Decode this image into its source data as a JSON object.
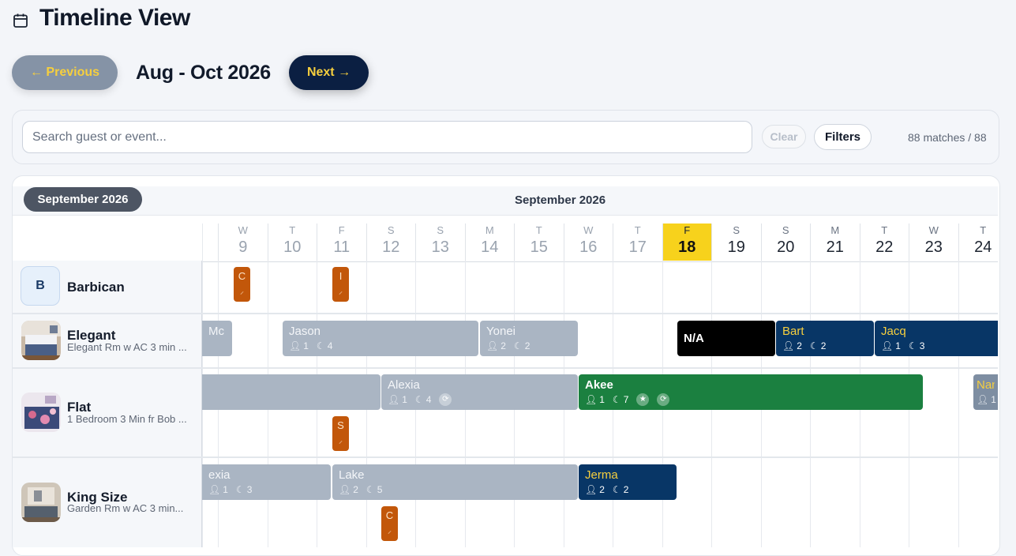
{
  "header": {
    "title": "Timeline View",
    "title_icon": "calendar-icon"
  },
  "nav": {
    "prev_label": "← Previous",
    "range_label": "Aug - Oct 2026",
    "next_label": "Next →"
  },
  "search": {
    "placeholder": "Search guest or event...",
    "value": "",
    "clear_label": "Clear",
    "filters_label": "Filters",
    "match_count": "88 matches / 88"
  },
  "timeline": {
    "month_pill": "September 2026",
    "month_heading": "September 2026",
    "days": [
      {
        "dow": "W",
        "num": "9"
      },
      {
        "dow": "T",
        "num": "10"
      },
      {
        "dow": "F",
        "num": "11"
      },
      {
        "dow": "S",
        "num": "12"
      },
      {
        "dow": "S",
        "num": "13"
      },
      {
        "dow": "M",
        "num": "14"
      },
      {
        "dow": "T",
        "num": "15"
      },
      {
        "dow": "W",
        "num": "16"
      },
      {
        "dow": "T",
        "num": "17"
      },
      {
        "dow": "F",
        "num": "18"
      },
      {
        "dow": "S",
        "num": "19"
      },
      {
        "dow": "S",
        "num": "20"
      },
      {
        "dow": "M",
        "num": "21"
      },
      {
        "dow": "T",
        "num": "22"
      },
      {
        "dow": "W",
        "num": "23"
      },
      {
        "dow": "T",
        "num": "24"
      }
    ],
    "today_index": 9,
    "rooms": [
      {
        "name": "Barbican",
        "subtitle": "",
        "initial": "B"
      },
      {
        "name": "Elegant",
        "subtitle": "Elegant Rm w AC 3 min ..."
      },
      {
        "name": "Flat",
        "subtitle": "1 Bedroom 3 Min fr Bob ..."
      },
      {
        "name": "King Size",
        "subtitle": "Garden Rm w AC 3 min..."
      }
    ],
    "bookings": {
      "b1": {
        "name": "C",
        "icon": "broom-icon"
      },
      "b2": {
        "name": "I",
        "icon": "broom-icon"
      },
      "e1": {
        "name": "Mc"
      },
      "e2": {
        "name": "Jason",
        "guests": "1",
        "nights": "4"
      },
      "e3": {
        "name": "Yonei",
        "guests": "2",
        "nights": "2"
      },
      "e4": {
        "name": "N/A"
      },
      "e5": {
        "name": "Bart",
        "guests": "2",
        "nights": "2"
      },
      "e6": {
        "name": "Jacq",
        "guests": "1",
        "nights": "3"
      },
      "f2": {
        "name": "Alexia",
        "guests": "1",
        "nights": "4"
      },
      "f3": {
        "name": "Akee",
        "guests": "1",
        "nights": "7"
      },
      "f4": {
        "name": "Nan",
        "guests": "1"
      },
      "f5": {
        "name": "S"
      },
      "k1": {
        "name": "exia",
        "guests": "1",
        "nights": "3"
      },
      "k2": {
        "name": "Lake",
        "guests": "2",
        "nights": "5"
      },
      "k3": {
        "name": "Jerma",
        "guests": "2",
        "nights": "2"
      },
      "k4": {
        "name": "C"
      }
    }
  },
  "colors": {
    "accent_yellow": "#f7d21c",
    "navy": "#083666",
    "green": "#1b8040",
    "past": "#aab5c3",
    "cleaning": "#c2570a"
  }
}
